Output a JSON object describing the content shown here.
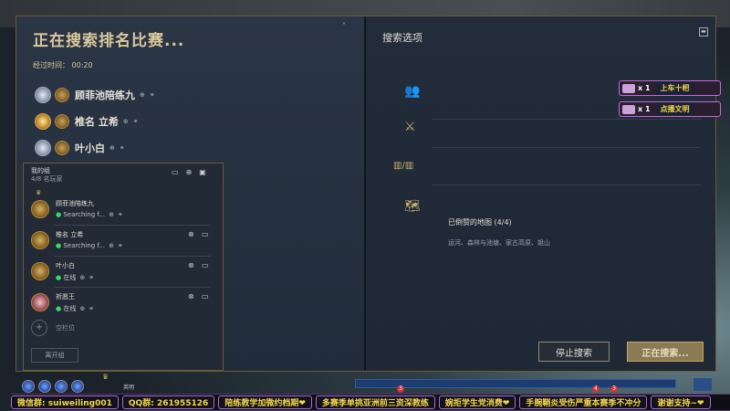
{
  "left": {
    "title": "正在搜索排名比赛...",
    "elapsed_label": "经过时间：",
    "elapsed_value": "00:20",
    "queue": [
      {
        "name": "顾菲池陪练九"
      },
      {
        "name": "椎名 立希"
      },
      {
        "name": "叶小白"
      }
    ]
  },
  "group": {
    "title": "我的组",
    "count": "4/8 名玩家",
    "members": [
      {
        "name": "顾菲池陪练九",
        "status": "Searching f..."
      },
      {
        "name": "椎名 立希",
        "status": "Searching f..."
      },
      {
        "name": "叶小白",
        "status": "在线"
      },
      {
        "name": "祈愿王",
        "status": "在线"
      }
    ],
    "empty_slot": "空栏位",
    "leave_label": "离开组"
  },
  "right": {
    "title": "搜索选项",
    "map_label": "已倒赞的地图 (4/4)",
    "maps": "运河、森林与池塘、家古高原、姐山",
    "stop_label": "停止搜索",
    "searching_label": "正在搜索..."
  },
  "gifts": [
    {
      "count": "x 1",
      "label": "上车十杷"
    },
    {
      "count": "x 1",
      "label": "点播文明"
    }
  ],
  "ticker": [
    "微信群: suiweiling001",
    "QQ群: 261955126",
    "陪练教学加微约档期❤",
    "多赛季单挑亚洲前三资深教练",
    "婉拒学生党消费❤",
    "手腕鞘炎受伤严重本赛季不冲分",
    "谢谢支持~❤"
  ],
  "bottom": {
    "name": "英明",
    "badges": [
      "3",
      "4",
      "3"
    ]
  }
}
